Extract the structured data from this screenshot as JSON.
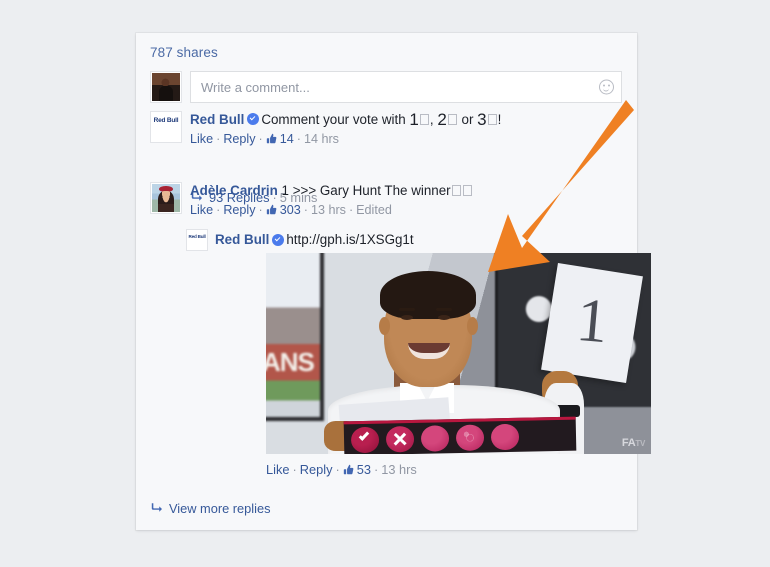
{
  "page": {
    "background_color": "#eceef1",
    "card_background": "#f7f8fa",
    "accent_link_color": "#365899",
    "arrow_color": "#ef8023"
  },
  "post": {
    "shares_label": "787 shares"
  },
  "composer": {
    "placeholder": "Write a comment...",
    "value": "",
    "avatar_name": "user-avatar",
    "emoji_icon": "smiley-icon"
  },
  "comments": [
    {
      "author": "Red Bull",
      "verified": true,
      "avatar_name": "red-bull-logo-avatar",
      "message_prefix": "Comment your vote with ",
      "message_num1": "1",
      "message_sep1": ", ",
      "message_num2": "2",
      "message_sep2": " or ",
      "message_num3": "3",
      "message_suffix": "!",
      "like_label": "Like",
      "reply_label": "Reply",
      "like_count": "14",
      "timestamp": "14 hrs",
      "replies_count": "93 Replies",
      "replies_time": "5 mins"
    },
    {
      "author": "Adèle Cardrin",
      "verified": false,
      "avatar_name": "adele-cardrin-avatar",
      "message": "1 >>> Gary Hunt The winner",
      "like_label": "Like",
      "reply_label": "Reply",
      "like_count": "303",
      "timestamp": "13 hrs",
      "edited_label": "Edited",
      "reply": {
        "author": "Red Bull",
        "verified": true,
        "avatar_name": "red-bull-logo-avatar-small",
        "link_text": "http://gph.is/1XSGg1t",
        "like_label": "Like",
        "reply_label": "Reply",
        "like_count": "53",
        "timestamp": "13 hrs",
        "media": {
          "type": "gif-video",
          "card_number": "1",
          "wall_photo_text": "ANS",
          "watermark": "FA",
          "watermark_small": "TV",
          "reactions": [
            "check-icon",
            "x-icon",
            "circle",
            "ball-icon",
            "circle"
          ]
        }
      }
    }
  ],
  "footer": {
    "view_more_replies": "View more replies"
  }
}
